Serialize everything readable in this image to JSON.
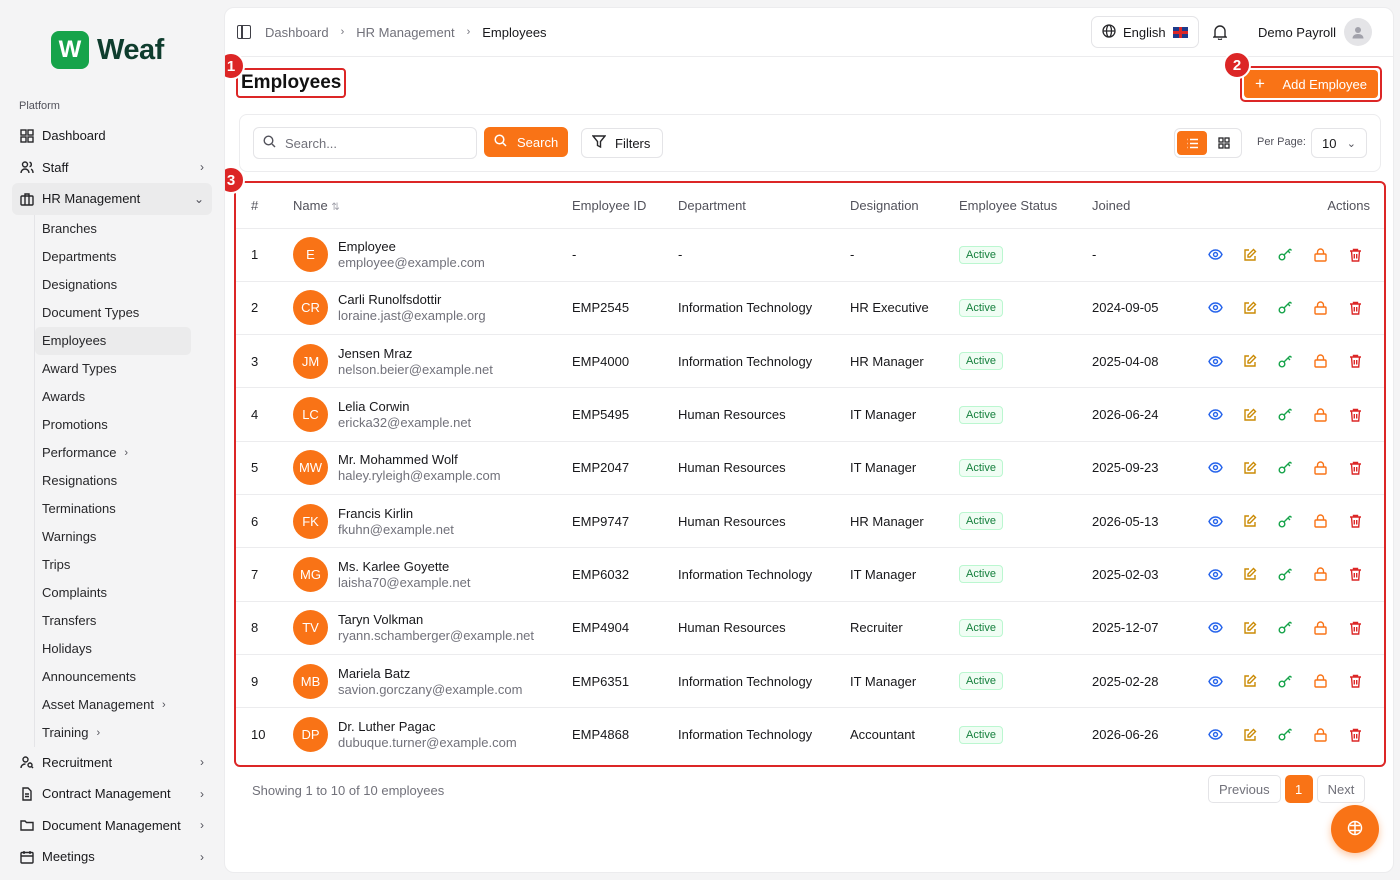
{
  "brand": {
    "logo_letter": "W",
    "name": "Weaf",
    "color": "#16a34a"
  },
  "sidebar": {
    "section_label": "Platform",
    "items": [
      {
        "label": "Dashboard",
        "icon": "grid-icon"
      },
      {
        "label": "Staff",
        "icon": "users-icon",
        "has_children": true
      },
      {
        "label": "HR Management",
        "icon": "briefcase-icon",
        "expanded": true
      }
    ],
    "hr_subitems": [
      {
        "label": "Branches"
      },
      {
        "label": "Departments"
      },
      {
        "label": "Designations"
      },
      {
        "label": "Document Types"
      },
      {
        "label": "Employees",
        "current": true
      },
      {
        "label": "Award Types"
      },
      {
        "label": "Awards"
      },
      {
        "label": "Promotions"
      },
      {
        "label": "Performance",
        "has_children": true
      },
      {
        "label": "Resignations"
      },
      {
        "label": "Terminations"
      },
      {
        "label": "Warnings"
      },
      {
        "label": "Trips"
      },
      {
        "label": "Complaints"
      },
      {
        "label": "Transfers"
      },
      {
        "label": "Holidays"
      },
      {
        "label": "Announcements"
      },
      {
        "label": "Asset Management",
        "has_children": true
      },
      {
        "label": "Training",
        "has_children": true
      }
    ],
    "bottom_items": [
      {
        "label": "Recruitment",
        "icon": "user-search-icon"
      },
      {
        "label": "Contract Management",
        "icon": "file-text-icon"
      },
      {
        "label": "Document Management",
        "icon": "folder-icon"
      },
      {
        "label": "Meetings",
        "icon": "calendar-icon"
      }
    ]
  },
  "header": {
    "breadcrumb": [
      "Dashboard",
      "HR Management",
      "Employees"
    ],
    "language": "English",
    "user_name": "Demo Payroll"
  },
  "page": {
    "title": "Employees",
    "add_button": "Add Employee",
    "annotations": [
      "1",
      "2",
      "3"
    ]
  },
  "toolbar": {
    "search_placeholder": "Search...",
    "search_button": "Search",
    "filters_button": "Filters",
    "per_page_label": "Per Page:",
    "per_page_value": "10"
  },
  "table": {
    "columns": [
      "#",
      "Name",
      "Employee ID",
      "Department",
      "Designation",
      "Employee Status",
      "Joined",
      "Actions"
    ],
    "rows": [
      {
        "num": "1",
        "initials": "E",
        "name": "Employee",
        "email": "employee@example.com",
        "emp_id": "-",
        "department": "-",
        "designation": "-",
        "status": "Active",
        "joined": "-"
      },
      {
        "num": "2",
        "initials": "CR",
        "name": "Carli Runolfsdottir",
        "email": "loraine.jast@example.org",
        "emp_id": "EMP2545",
        "department": "Information Technology",
        "designation": "HR Executive",
        "status": "Active",
        "joined": "2024-09-05"
      },
      {
        "num": "3",
        "initials": "JM",
        "name": "Jensen Mraz",
        "email": "nelson.beier@example.net",
        "emp_id": "EMP4000",
        "department": "Information Technology",
        "designation": "HR Manager",
        "status": "Active",
        "joined": "2025-04-08"
      },
      {
        "num": "4",
        "initials": "LC",
        "name": "Lelia Corwin",
        "email": "ericka32@example.net",
        "emp_id": "EMP5495",
        "department": "Human Resources",
        "designation": "IT Manager",
        "status": "Active",
        "joined": "2026-06-24"
      },
      {
        "num": "5",
        "initials": "MW",
        "name": "Mr. Mohammed Wolf",
        "email": "haley.ryleigh@example.com",
        "emp_id": "EMP2047",
        "department": "Human Resources",
        "designation": "IT Manager",
        "status": "Active",
        "joined": "2025-09-23"
      },
      {
        "num": "6",
        "initials": "FK",
        "name": "Francis Kirlin",
        "email": "fkuhn@example.net",
        "emp_id": "EMP9747",
        "department": "Human Resources",
        "designation": "HR Manager",
        "status": "Active",
        "joined": "2026-05-13"
      },
      {
        "num": "7",
        "initials": "MG",
        "name": "Ms. Karlee Goyette",
        "email": "laisha70@example.net",
        "emp_id": "EMP6032",
        "department": "Information Technology",
        "designation": "IT Manager",
        "status": "Active",
        "joined": "2025-02-03"
      },
      {
        "num": "8",
        "initials": "TV",
        "name": "Taryn Volkman",
        "email": "ryann.schamberger@example.net",
        "emp_id": "EMP4904",
        "department": "Human Resources",
        "designation": "Recruiter",
        "status": "Active",
        "joined": "2025-12-07"
      },
      {
        "num": "9",
        "initials": "MB",
        "name": "Mariela Batz",
        "email": "savion.gorczany@example.com",
        "emp_id": "EMP6351",
        "department": "Information Technology",
        "designation": "IT Manager",
        "status": "Active",
        "joined": "2025-02-28"
      },
      {
        "num": "10",
        "initials": "DP",
        "name": "Dr. Luther Pagac",
        "email": "dubuque.turner@example.com",
        "emp_id": "EMP4868",
        "department": "Information Technology",
        "designation": "Accountant",
        "status": "Active",
        "joined": "2026-06-26"
      }
    ]
  },
  "footer": {
    "showing_text": "Showing 1 to 10 of 10 employees",
    "previous": "Previous",
    "current_page": "1",
    "next": "Next"
  },
  "colors": {
    "accent": "#f97316",
    "annotation": "#dc2626",
    "status_active": "#15803d"
  }
}
